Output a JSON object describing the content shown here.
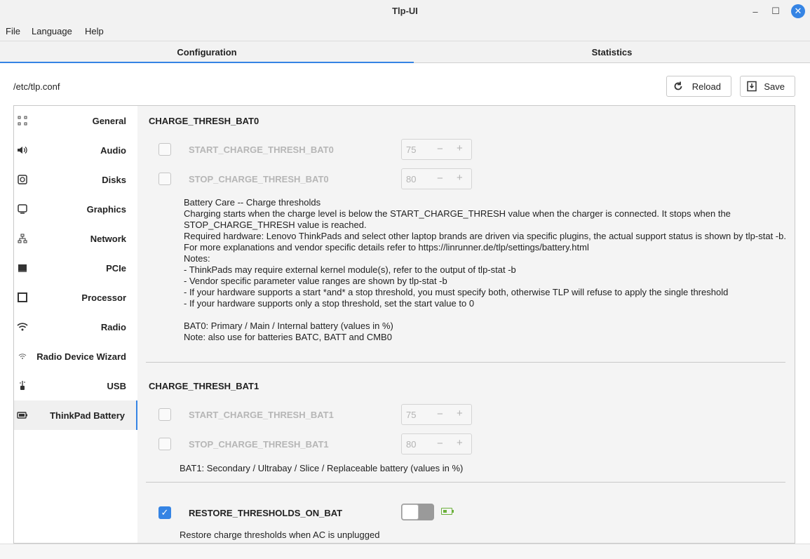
{
  "window": {
    "title": "Tlp-UI"
  },
  "menu": {
    "file": "File",
    "language": "Language",
    "help": "Help"
  },
  "tabs": {
    "configuration": "Configuration",
    "statistics": "Statistics"
  },
  "toolbar": {
    "path": "/etc/tlp.conf",
    "reload": "Reload",
    "save": "Save"
  },
  "sidebar": {
    "items": [
      {
        "label": "General",
        "icon": "grid-icon"
      },
      {
        "label": "Audio",
        "icon": "speaker-icon"
      },
      {
        "label": "Disks",
        "icon": "disk-icon"
      },
      {
        "label": "Graphics",
        "icon": "monitor-icon"
      },
      {
        "label": "Network",
        "icon": "network-icon"
      },
      {
        "label": "PCIe",
        "icon": "pcie-icon"
      },
      {
        "label": "Processor",
        "icon": "processor-icon"
      },
      {
        "label": "Radio",
        "icon": "wifi-icon"
      },
      {
        "label": "Radio Device Wizard",
        "icon": "radio-wizard-icon"
      },
      {
        "label": "USB",
        "icon": "usb-icon"
      },
      {
        "label": "ThinkPad Battery",
        "icon": "battery-icon"
      }
    ],
    "active": "ThinkPad Battery"
  },
  "bat0": {
    "title": "CHARGE_THRESH_BAT0",
    "start": {
      "name": "START_CHARGE_THRESH_BAT0",
      "value": "75",
      "checked": false
    },
    "stop": {
      "name": "STOP_CHARGE_THRESH_BAT0",
      "value": "80",
      "checked": false
    },
    "description": [
      "Battery Care -- Charge thresholds",
      "Charging starts when the charge level is below the START_CHARGE_THRESH value when the charger is connected. It stops when the STOP_CHARGE_THRESH value is reached.",
      "Required hardware: Lenovo ThinkPads and select other laptop brands are driven via specific plugins, the actual support status is shown by tlp-stat -b.",
      "For more explanations and vendor specific details refer to https://linrunner.de/tlp/settings/battery.html",
      "Notes:",
      "- ThinkPads may require external kernel module(s), refer to the output of tlp-stat -b",
      "- Vendor specific parameter value ranges are shown by tlp-stat -b",
      "- If your hardware supports a start *and* a stop threshold, you must specify both, otherwise TLP will refuse to apply the single threshold",
      "- If your hardware supports only a stop threshold, set the start value to 0",
      "",
      "BAT0: Primary / Main / Internal battery (values in %)",
      "Note: also use for batteries BATC, BATT and CMB0"
    ]
  },
  "bat1": {
    "title": "CHARGE_THRESH_BAT1",
    "start": {
      "name": "START_CHARGE_THRESH_BAT1",
      "value": "75",
      "checked": false
    },
    "stop": {
      "name": "STOP_CHARGE_THRESH_BAT1",
      "value": "80",
      "checked": false
    },
    "note": "BAT1: Secondary / Ultrabay / Slice / Replaceable battery (values in %)"
  },
  "restore": {
    "name": "RESTORE_THRESHOLDS_ON_BAT",
    "checked": true,
    "toggle_on": false,
    "description": "Restore charge thresholds when AC is unplugged"
  },
  "colors": {
    "accent": "#3584e4",
    "battery_green": "#6bb13b"
  }
}
